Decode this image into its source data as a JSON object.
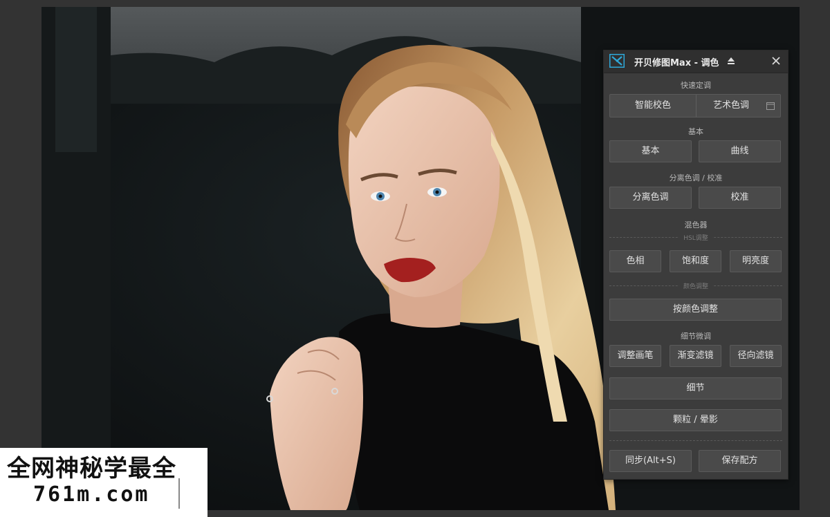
{
  "panel": {
    "title": "开贝修图Max - 调色",
    "sections": {
      "quick": "快速定调",
      "basic": "基本",
      "split": "分离色调 / 校准",
      "mixer": "混色器",
      "hsl_sub": "HSL调整",
      "color_sub": "颜色调整",
      "detail": "细节微调"
    },
    "buttons": {
      "smart_color": "智能校色",
      "art_tone": "艺术色调",
      "basic": "基本",
      "curve": "曲线",
      "split_tone": "分离色调",
      "calibrate": "校准",
      "hue": "色相",
      "saturation": "饱和度",
      "luminance": "明亮度",
      "by_color": "按颜色调整",
      "brush": "调整画笔",
      "gradient": "渐变滤镜",
      "radial": "径向滤镜",
      "detail": "细节",
      "grain": "颗粒 / 晕影",
      "sync": "同步(Alt+S)",
      "save_preset": "保存配方"
    },
    "icons": {
      "logo": "app-logo-icon",
      "eject": "eject-icon",
      "close": "close-icon",
      "calendar": "calendar-icon"
    },
    "accent": "#2ea8d8"
  },
  "watermark": {
    "line1": "全网神秘学最全",
    "line2": "761m.com"
  }
}
